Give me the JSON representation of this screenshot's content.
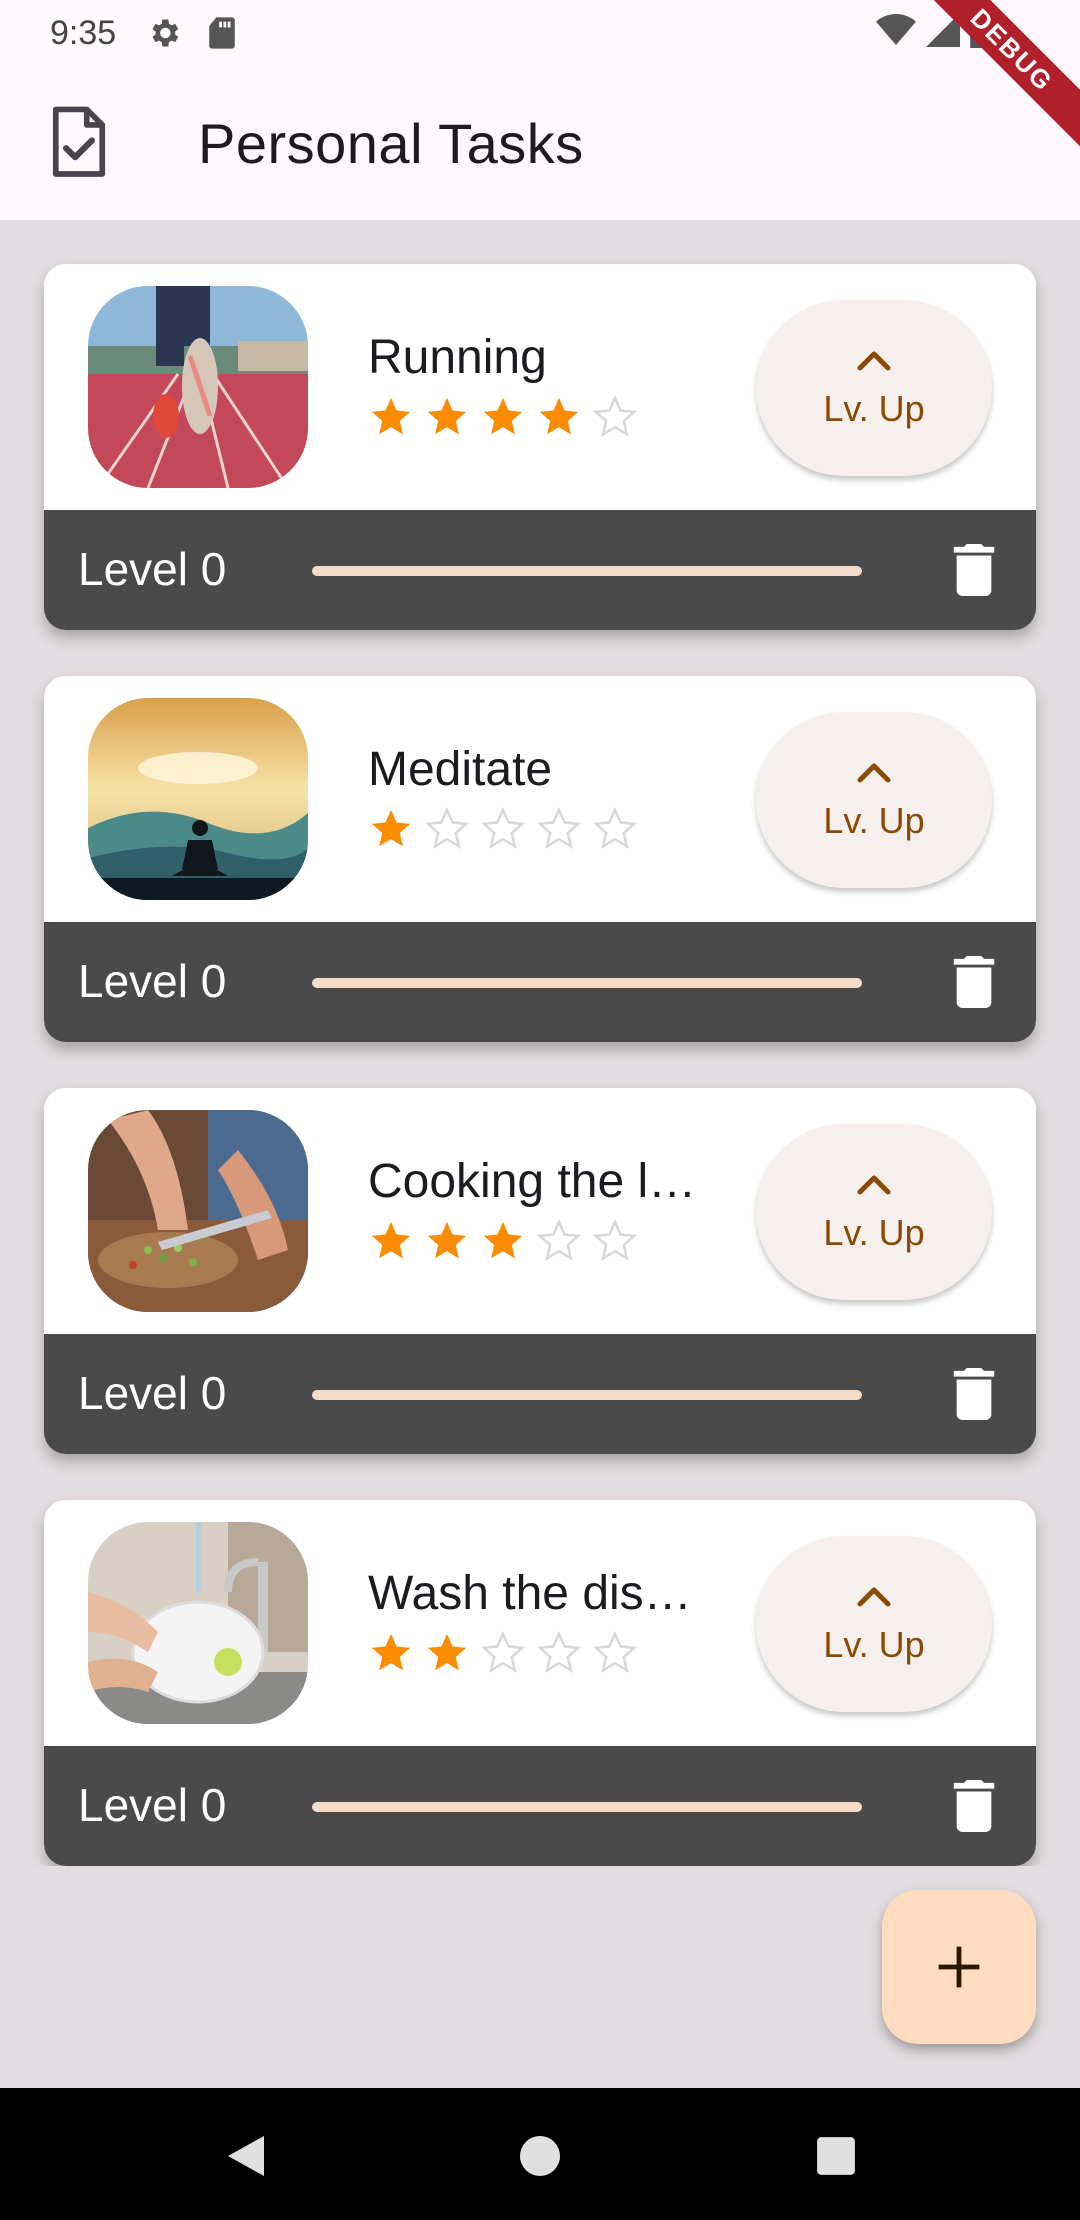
{
  "status_bar": {
    "time": "9:35",
    "icons": [
      "gear-icon",
      "sd-card-icon",
      "wifi-icon",
      "signal-icon",
      "battery-icon"
    ]
  },
  "debug_banner": "DEBUG",
  "app_bar": {
    "icon": "task-checklist-icon",
    "title": "Personal Tasks"
  },
  "tasks": [
    {
      "name": "Running",
      "rating": 4,
      "max_rating": 5,
      "level_label": "Level 0",
      "progress": 0,
      "level_up_label": "Lv. Up",
      "image": "running-track-photo"
    },
    {
      "name": "Meditate",
      "rating": 1,
      "max_rating": 5,
      "level_label": "Level 0",
      "progress": 0,
      "level_up_label": "Lv. Up",
      "image": "meditation-sunset-photo"
    },
    {
      "name": "Cooking the l…",
      "rating": 3,
      "max_rating": 5,
      "level_label": "Level 0",
      "progress": 0,
      "level_up_label": "Lv. Up",
      "image": "cooking-chopping-photo"
    },
    {
      "name": "Wash the dis…",
      "rating": 2,
      "max_rating": 5,
      "level_label": "Level 0",
      "progress": 0,
      "level_up_label": "Lv. Up",
      "image": "washing-dishes-photo"
    }
  ],
  "fab": {
    "icon": "plus-icon"
  },
  "nav_bar": {
    "icons": [
      "back-triangle-icon",
      "home-circle-icon",
      "recents-square-icon"
    ]
  },
  "colors": {
    "background": "#e2dde0",
    "app_bar": "#fdf8fb",
    "card_footer": "#4b4a4b",
    "star_filled": "#fb8c00",
    "star_empty": "#d8d8d8",
    "level_up_text": "#8a4a00",
    "progress_track": "#f4dcc8",
    "fab": "#ffdcbf"
  }
}
